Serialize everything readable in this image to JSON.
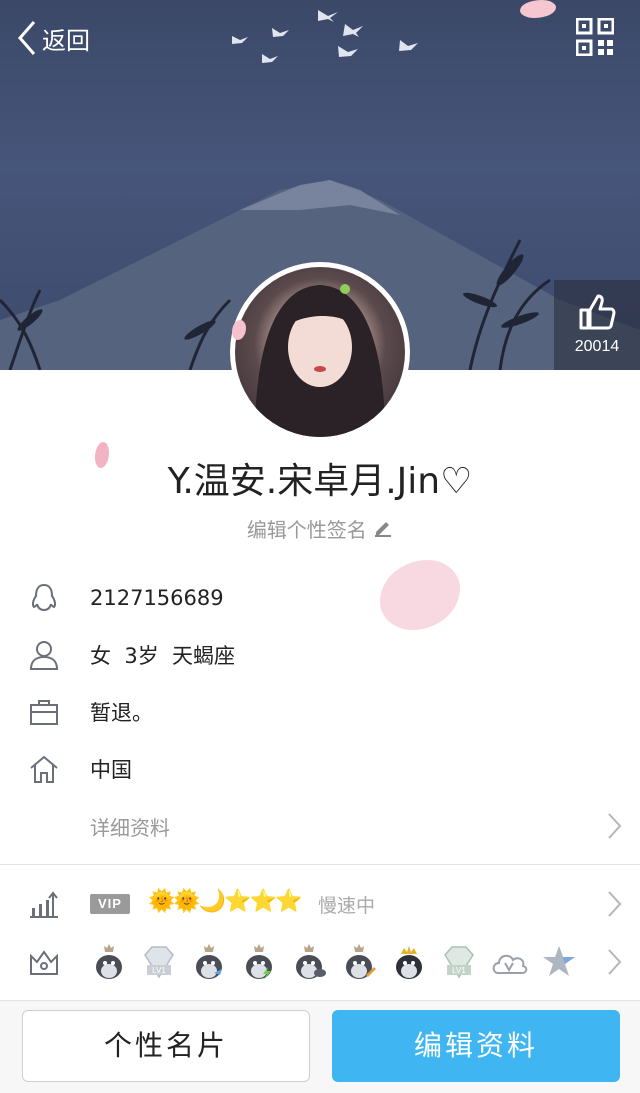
{
  "nav": {
    "back_label": "返回"
  },
  "like": {
    "count": "20014"
  },
  "profile": {
    "nickname": "Y.温安.宋卓月.Jin♡",
    "signature_prompt": "编辑个性签名"
  },
  "info": {
    "qq_number": "2127156689",
    "basic": "女  3岁  天蝎座",
    "occupation": "暂退。",
    "location": "中国",
    "detail_link": "详细资料"
  },
  "vip": {
    "tag": "VIP",
    "level_icons": "🌞🌞🌙⭐⭐⭐",
    "speed_text": "慢速中"
  },
  "badges": [
    "penguin-badge",
    "diamond-lv1-badge",
    "penguin-fish-badge",
    "penguin-lightning-badge",
    "penguin-phone-badge",
    "penguin-pencil-badge",
    "penguin-crown-badge",
    "diamond-lv1-badge",
    "cloud-v-badge",
    "star-badge"
  ],
  "badge_text": {
    "lv": "LV1"
  },
  "buttons": {
    "card": "个性名片",
    "edit": "编辑资料"
  },
  "colors": {
    "accent": "#3fb5f2",
    "header": "#434f71"
  }
}
